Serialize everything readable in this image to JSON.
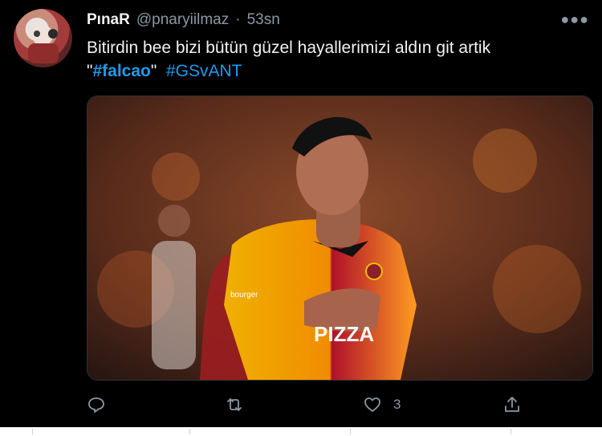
{
  "tweet": {
    "author_name": "PınaR",
    "author_handle": "@pnaryiilmaz",
    "separator": "·",
    "time": "53sn",
    "text_line1": "Bitirdin bee bizi bütün güzel hayallerimizi aldın git artik",
    "quote_open": "\"",
    "hashtag1": "#falcao",
    "quote_close": "\"",
    "hashtag2": "#GSvANT"
  },
  "actions": {
    "reply_count": "",
    "retweet_count": "",
    "like_count": "3"
  },
  "colors": {
    "background": "#000000",
    "link": "#1d9bf0",
    "muted": "#8b98a5"
  },
  "icons": [
    "avatar",
    "more-icon",
    "reply-icon",
    "retweet-icon",
    "like-icon",
    "share-icon"
  ],
  "media": {
    "jersey_text": "PIZZA",
    "sponsor_text": "bourger"
  }
}
